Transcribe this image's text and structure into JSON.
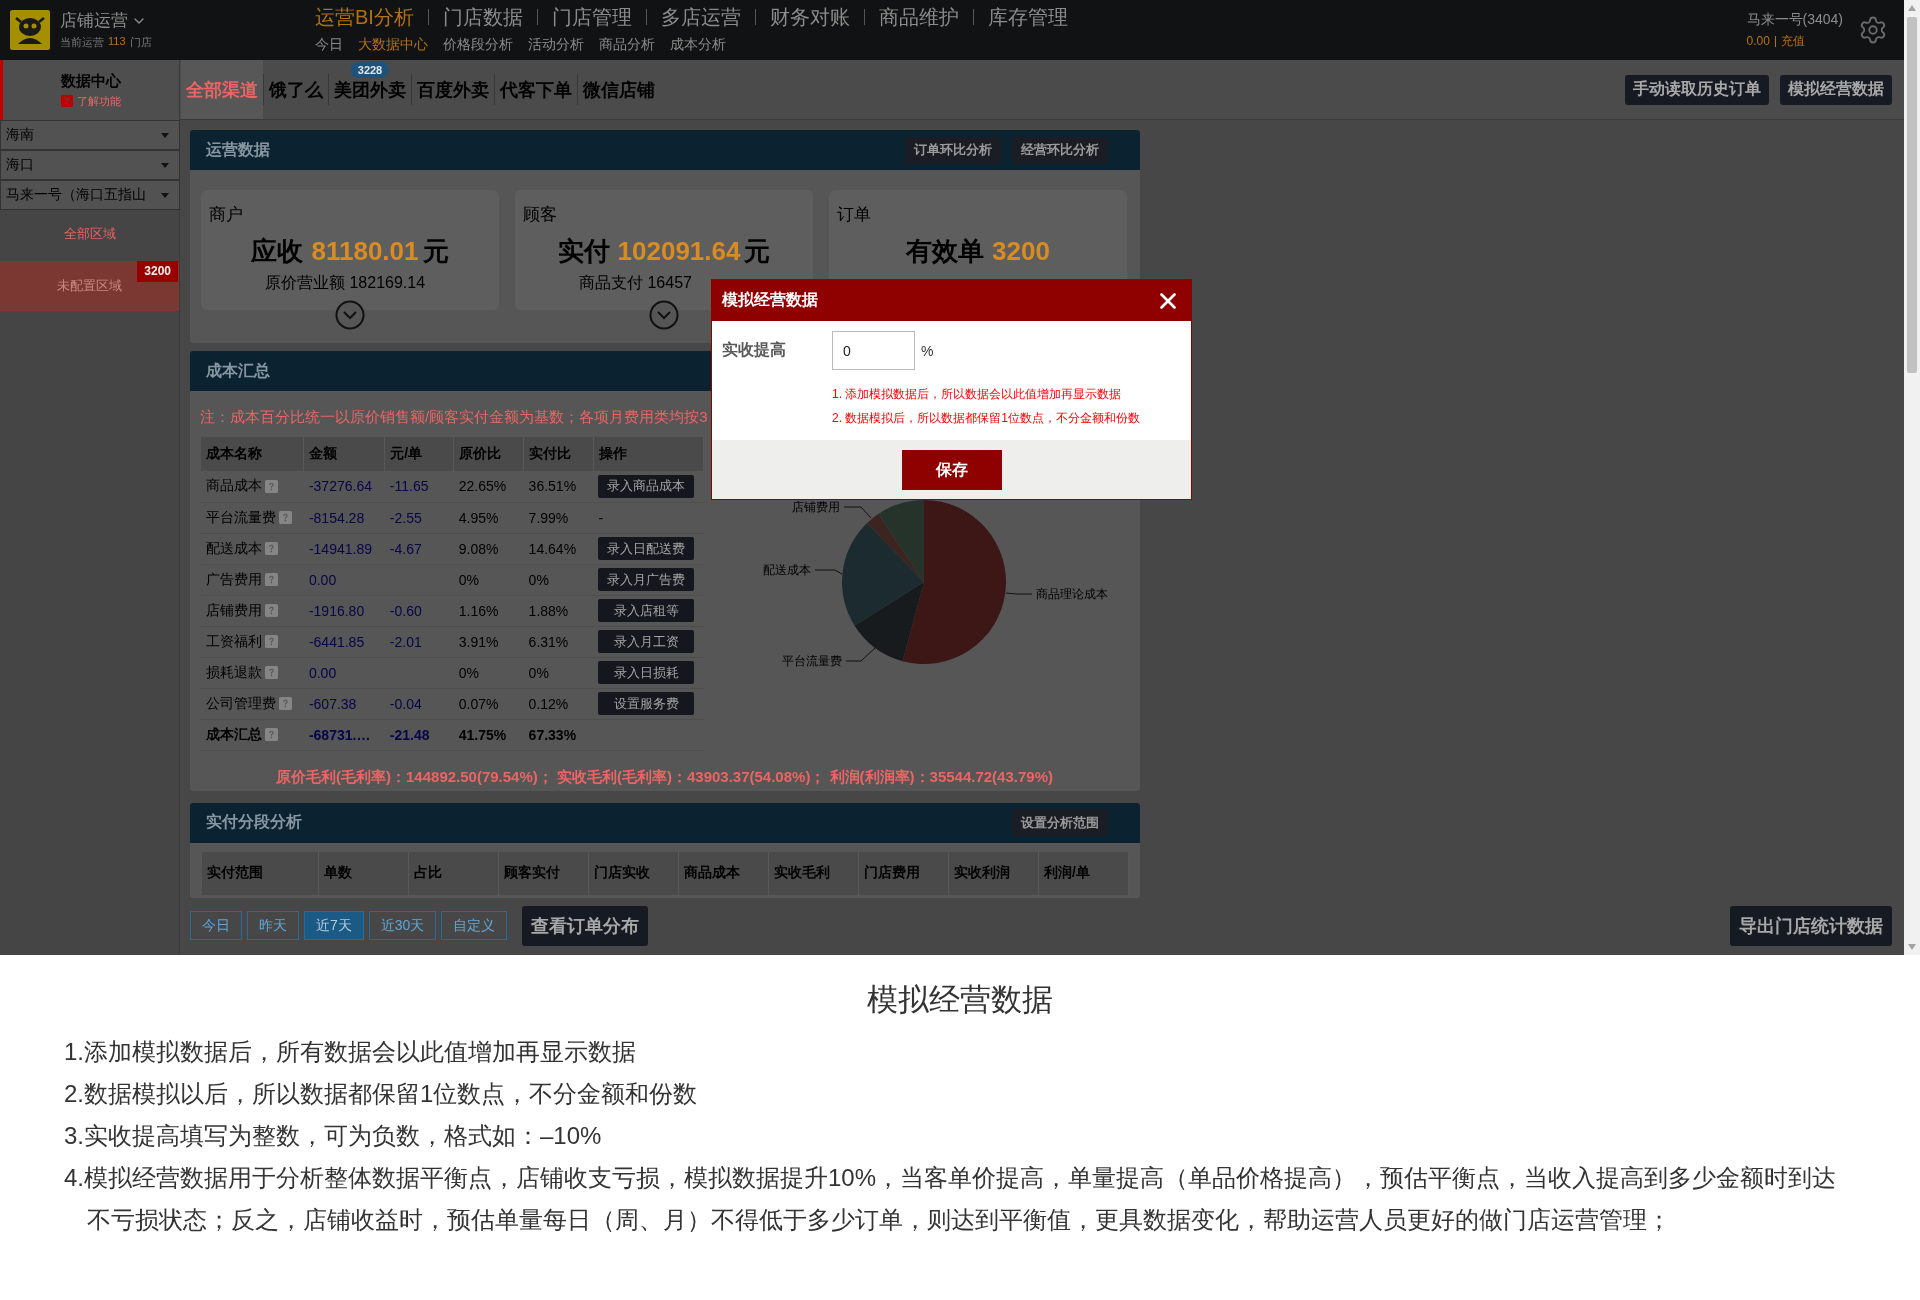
{
  "header": {
    "brand": {
      "title": "店铺运营",
      "caption": "当前运营",
      "count": "113",
      "unit": "门店"
    },
    "nav": [
      {
        "label": "运营BI分析",
        "selected": true
      },
      {
        "label": "门店数据",
        "selected": false
      },
      {
        "label": "门店管理",
        "selected": false
      },
      {
        "label": "多店运营",
        "selected": false
      },
      {
        "label": "财务对账",
        "selected": false
      },
      {
        "label": "商品维护",
        "selected": false
      },
      {
        "label": "库存管理",
        "selected": false
      }
    ],
    "sub_nav": [
      {
        "label": "今日",
        "selected": false
      },
      {
        "label": "大数据中心",
        "selected": true
      },
      {
        "label": "价格段分析",
        "selected": false
      },
      {
        "label": "活动分析",
        "selected": false
      },
      {
        "label": "商品分析",
        "selected": false
      },
      {
        "label": "成本分析",
        "selected": false
      }
    ],
    "account": {
      "name": "马来一号(3404)",
      "balance": "0.00",
      "action": "充值"
    }
  },
  "sidebar": {
    "title": "数据中心",
    "help": "了解功能",
    "filters": [
      "海南",
      "海口",
      "马来一号（海口五指山"
    ],
    "region_link": "全部区域",
    "unassigned": {
      "label": "未配置区域",
      "badge": "3200"
    }
  },
  "channels": {
    "tabs": [
      {
        "label": "全部渠道",
        "selected": true
      },
      {
        "label": "饿了么",
        "selected": false
      },
      {
        "label": "美团外卖",
        "selected": false,
        "badge": "3228"
      },
      {
        "label": "百度外卖",
        "selected": false
      },
      {
        "label": "代客下单",
        "selected": false
      },
      {
        "label": "微信店铺",
        "selected": false
      }
    ],
    "actions": [
      "手动读取历史订单",
      "模拟经营数据"
    ]
  },
  "operations": {
    "title": "运营数据",
    "actions": [
      "订单环比分析",
      "经营环比分析"
    ],
    "cards": [
      {
        "label": "商户",
        "metric": "应收",
        "value": "81180.01",
        "unit": "元",
        "detail": "原价营业额 182169.14",
        "expandable": true
      },
      {
        "label": "顾客",
        "metric": "实付",
        "value": "102091.64",
        "unit": "元",
        "detail": "商品支付 16457",
        "expandable": true
      },
      {
        "label": "订单",
        "metric": "有效单",
        "value": "3200",
        "expandable": false
      }
    ]
  },
  "cost": {
    "title": "成本汇总",
    "note": "注：成本百分比统一以原价销售额/顾客实付金额为基数；各项月费用类均按3",
    "columns": [
      "成本名称",
      "金额",
      "元/单",
      "原价比",
      "实付比",
      "操作"
    ],
    "rows": [
      {
        "kind": "item",
        "name": "商品成本",
        "amount": "-37276.64",
        "per_order": "-11.65",
        "cost_ratio": "22.65%",
        "paid_ratio": "36.51%",
        "action": {
          "kind": "button",
          "label": "录入商品成本"
        }
      },
      {
        "kind": "item",
        "name": "平台流量费",
        "amount": "-8154.28",
        "per_order": "-2.55",
        "cost_ratio": "4.95%",
        "paid_ratio": "7.99%",
        "action": {
          "kind": "text",
          "label": "-"
        }
      },
      {
        "kind": "item",
        "name": "配送成本",
        "amount": "-14941.89",
        "per_order": "-4.67",
        "cost_ratio": "9.08%",
        "paid_ratio": "14.64%",
        "action": {
          "kind": "button",
          "label": "录入日配送费"
        }
      },
      {
        "kind": "item",
        "name": "广告费用",
        "amount": "0.00",
        "cost_ratio": "0%",
        "paid_ratio": "0%",
        "action": {
          "kind": "button",
          "label": "录入月广告费"
        }
      },
      {
        "kind": "item",
        "name": "店铺费用",
        "amount": "-1916.80",
        "per_order": "-0.60",
        "cost_ratio": "1.16%",
        "paid_ratio": "1.88%",
        "action": {
          "kind": "button",
          "label": "录入店租等"
        }
      },
      {
        "kind": "item",
        "name": "工资福利",
        "amount": "-6441.85",
        "per_order": "-2.01",
        "cost_ratio": "3.91%",
        "paid_ratio": "6.31%",
        "action": {
          "kind": "button",
          "label": "录入月工资"
        }
      },
      {
        "kind": "item",
        "name": "损耗退款",
        "amount": "0.00",
        "cost_ratio": "0%",
        "paid_ratio": "0%",
        "action": {
          "kind": "button",
          "label": "录入日损耗"
        }
      },
      {
        "kind": "item",
        "name": "公司管理费",
        "amount": "-607.38",
        "per_order": "-0.04",
        "cost_ratio": "0.07%",
        "paid_ratio": "0.12%",
        "action": {
          "kind": "button",
          "label": "设置服务费"
        }
      },
      {
        "kind": "total",
        "name": "成本汇总",
        "amount": "-68731.…",
        "per_order": "-21.48",
        "cost_ratio": "41.75%",
        "paid_ratio": "67.33%"
      }
    ],
    "summary": "原价毛利(毛利率)：144892.50(79.54%)； 实收毛利(毛利率)：43903.37(54.08%)； 利润(利润率)：35544.72(43.79%)",
    "pie_labels": [
      "店铺费用",
      "配送成本",
      "平台流量费",
      "商品理论成本"
    ]
  },
  "segments": {
    "title": "实付分段分析",
    "action": "设置分析范围",
    "columns": [
      "实付范围",
      "单数",
      "占比",
      "顾客实付",
      "门店实收",
      "商品成本",
      "实收毛利",
      "门店费用",
      "实收利润",
      "利润/单"
    ]
  },
  "ranges": [
    {
      "label": "今日",
      "selected": false
    },
    {
      "label": "昨天",
      "selected": false
    },
    {
      "label": "近7天",
      "selected": true
    },
    {
      "label": "近30天",
      "selected": false
    },
    {
      "label": "自定义",
      "selected": false
    }
  ],
  "view_button": "查看订单分布",
  "export_button": "导出门店统计数据",
  "modal": {
    "title": "模拟经营数据",
    "field_label": "实收提高",
    "value": "0",
    "suffix": "%",
    "hints": [
      "1. 添加模拟数据后，所以数据会以此值增加再显示数据",
      "2. 数据模拟后，所以数据都保留1位数点，不分金额和份数"
    ],
    "save": "保存"
  },
  "caption": {
    "title": "模拟经营数据",
    "lines": [
      "1.添加模拟数据后，所有数据会以此值增加再显示数据",
      "2.数据模拟以后，所以数据都保留1位数点，不分金额和份数",
      "3.实收提高填写为整数，可为负数，格式如：–10%",
      "4.模拟经营数据用于分析整体数据平衡点，店铺收支亏损，模拟数据提升10%，当客单价提高，单量提高（单品价格提高），预估平衡点，当收入提高到多少金额时到达不亏损状态；反之，店铺收益时，预估单量每日（周、月）不得低于多少订单，则达到平衡值，更具数据变化，帮助运营人员更好的做门店运营管理；"
    ]
  }
}
